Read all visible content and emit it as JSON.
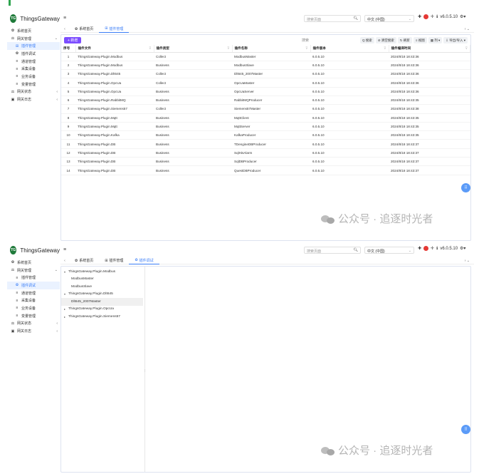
{
  "app": {
    "logo_text": "TG",
    "name": "ThingsGateway"
  },
  "sidebar1": [
    {
      "icon": "✿",
      "label": "系统首页",
      "level": 0,
      "chev": ""
    },
    {
      "icon": "⚖",
      "label": "网关管理",
      "level": 0,
      "chev": "⌄"
    },
    {
      "icon": "⊞",
      "label": "插件管理",
      "level": 1,
      "active": true,
      "chev": ""
    },
    {
      "icon": "✿",
      "label": "插件调试",
      "level": 1,
      "chev": ""
    },
    {
      "icon": "≡",
      "label": "通道管理",
      "level": 1,
      "chev": ""
    },
    {
      "icon": "≡",
      "label": "采集设备",
      "level": 1,
      "chev": ""
    },
    {
      "icon": "≡",
      "label": "业务设备",
      "level": 1,
      "chev": ""
    },
    {
      "icon": "≡",
      "label": "变量管理",
      "level": 1,
      "chev": ""
    },
    {
      "icon": "⚖",
      "label": "网关状态",
      "level": 0,
      "chev": "‹"
    },
    {
      "icon": "▣",
      "label": "网关日志",
      "level": 0,
      "chev": "‹"
    }
  ],
  "sidebar2": [
    {
      "icon": "✿",
      "label": "系统首页",
      "level": 0,
      "chev": ""
    },
    {
      "icon": "⚖",
      "label": "网关管理",
      "level": 0,
      "chev": "⌄"
    },
    {
      "icon": "≡",
      "label": "插件管理",
      "level": 1,
      "chev": ""
    },
    {
      "icon": "✿",
      "label": "插件调试",
      "level": 1,
      "active": true,
      "chev": ""
    },
    {
      "icon": "≡",
      "label": "通道管理",
      "level": 1,
      "chev": ""
    },
    {
      "icon": "≡",
      "label": "采集设备",
      "level": 1,
      "chev": ""
    },
    {
      "icon": "≡",
      "label": "业务设备",
      "level": 1,
      "chev": ""
    },
    {
      "icon": "≡",
      "label": "变量管理",
      "level": 1,
      "chev": ""
    },
    {
      "icon": "⚖",
      "label": "网关状态",
      "level": 0,
      "chev": "‹"
    },
    {
      "icon": "▣",
      "label": "网关日志",
      "level": 0,
      "chev": "‹"
    }
  ],
  "header": {
    "menu_icon": "≡",
    "search_placeholder": "搜索页面",
    "language": "中文 (中国)",
    "version": "v6.0.5.10",
    "icons": [
      "✚",
      "✛",
      "ℹ"
    ],
    "tab_left": "‹",
    "tab_right": "›  ⌄"
  },
  "tabs1": [
    {
      "icon": "✿",
      "label": "系统首页"
    },
    {
      "icon": "⊞",
      "label": "插件管理",
      "active": true
    }
  ],
  "tabs2": [
    {
      "icon": "✿",
      "label": "系统首页"
    },
    {
      "icon": "⊞",
      "label": "插件管理"
    },
    {
      "icon": "✿",
      "label": "插件调试",
      "active": true
    }
  ],
  "toolbar": {
    "add_label": "+ 新增",
    "search_label": "搜索",
    "buttons": [
      "Q 搜索",
      "⊘ 清空搜索",
      "↻ 刷新",
      "≡ 视图",
      "▦ 列 ▾",
      "⇩ 导出/导入 ▾"
    ]
  },
  "table": {
    "headers": [
      "序号",
      "插件文件",
      "插件类型",
      "插件名称",
      "插件版本",
      "插件编译时间"
    ],
    "rows": [
      [
        "1",
        "ThingsGateway.Plugin.Modbus",
        "Collect",
        "ModbusMaster",
        "6.0.5.10",
        "2024/8/18 18:43:36"
      ],
      [
        "2",
        "ThingsGateway.Plugin.Modbus",
        "Business",
        "ModbusSlave",
        "6.0.5.10",
        "2024/8/18 18:43:36"
      ],
      [
        "3",
        "ThingsGateway.Plugin.Dlt645",
        "Collect",
        "Dlt645_2007Master",
        "6.0.5.10",
        "2024/8/18 18:43:36"
      ],
      [
        "4",
        "ThingsGateway.Plugin.OpcUa",
        "Collect",
        "OpcUaMaster",
        "6.0.5.10",
        "2024/8/18 18:43:36"
      ],
      [
        "5",
        "ThingsGateway.Plugin.OpcUa",
        "Business",
        "OpcUaServer",
        "6.0.5.10",
        "2024/8/18 18:43:36"
      ],
      [
        "6",
        "ThingsGateway.Plugin.RabbitMQ",
        "Business",
        "RabbitMQProducer",
        "6.0.5.10",
        "2024/8/18 18:43:35"
      ],
      [
        "7",
        "ThingsGateway.Plugin.Siemens57",
        "Collect",
        "Siemens57Master",
        "6.0.5.10",
        "2024/8/18 18:43:38"
      ],
      [
        "8",
        "ThingsGateway.Plugin.Mqtt",
        "Business",
        "MqttClient",
        "6.0.5.10",
        "2024/8/18 18:43:35"
      ],
      [
        "9",
        "ThingsGateway.Plugin.Mqtt",
        "Business",
        "MqttServer",
        "6.0.5.10",
        "2024/8/18 18:43:35"
      ],
      [
        "10",
        "ThingsGateway.Plugin.Kafka",
        "Business",
        "KafkaProducer",
        "6.0.5.10",
        "2024/8/18 18:43:35"
      ],
      [
        "11",
        "ThingsGateway.Plugin.DB",
        "Business",
        "TDengineDBProducer",
        "6.0.5.10",
        "2024/8/18 18:43:37"
      ],
      [
        "12",
        "ThingsGateway.Plugin.DB",
        "Business",
        "SqlHisAlarm",
        "6.0.5.10",
        "2024/8/18 18:43:37"
      ],
      [
        "13",
        "ThingsGateway.Plugin.DB",
        "Business",
        "SqlDBProducer",
        "6.0.5.10",
        "2024/8/18 18:43:37"
      ],
      [
        "14",
        "ThingsGateway.Plugin.DB",
        "Business",
        "QuestDBProducer",
        "6.0.5.10",
        "2024/8/18 18:43:37"
      ]
    ]
  },
  "tree": [
    {
      "label": "ThingsGateway.Plugin.Modbus",
      "arrow": "▾",
      "child": false
    },
    {
      "label": "ModbusMaster",
      "arrow": "",
      "child": true
    },
    {
      "label": "ModbusSlave",
      "arrow": "",
      "child": true
    },
    {
      "label": "ThingsGateway.Plugin.Dlt645",
      "arrow": "▾",
      "child": false
    },
    {
      "label": "Dlt645_2007Master",
      "arrow": "",
      "child": true,
      "selected": true
    },
    {
      "label": "ThingsGateway.Plugin.OpcUa",
      "arrow": "▸",
      "child": false
    },
    {
      "label": "ThingsGateway.Plugin.Siemens57",
      "arrow": "▸",
      "child": false
    }
  ],
  "watermark": "公众号 · 追逐时光者",
  "fab_icon": "⠿",
  "splitter_icon": "⁝",
  "colors": {
    "accent": "#3b7ef7",
    "add_button": "#7c4dff",
    "logo": "#1f7a3a",
    "fab": "#5b9bf8"
  }
}
